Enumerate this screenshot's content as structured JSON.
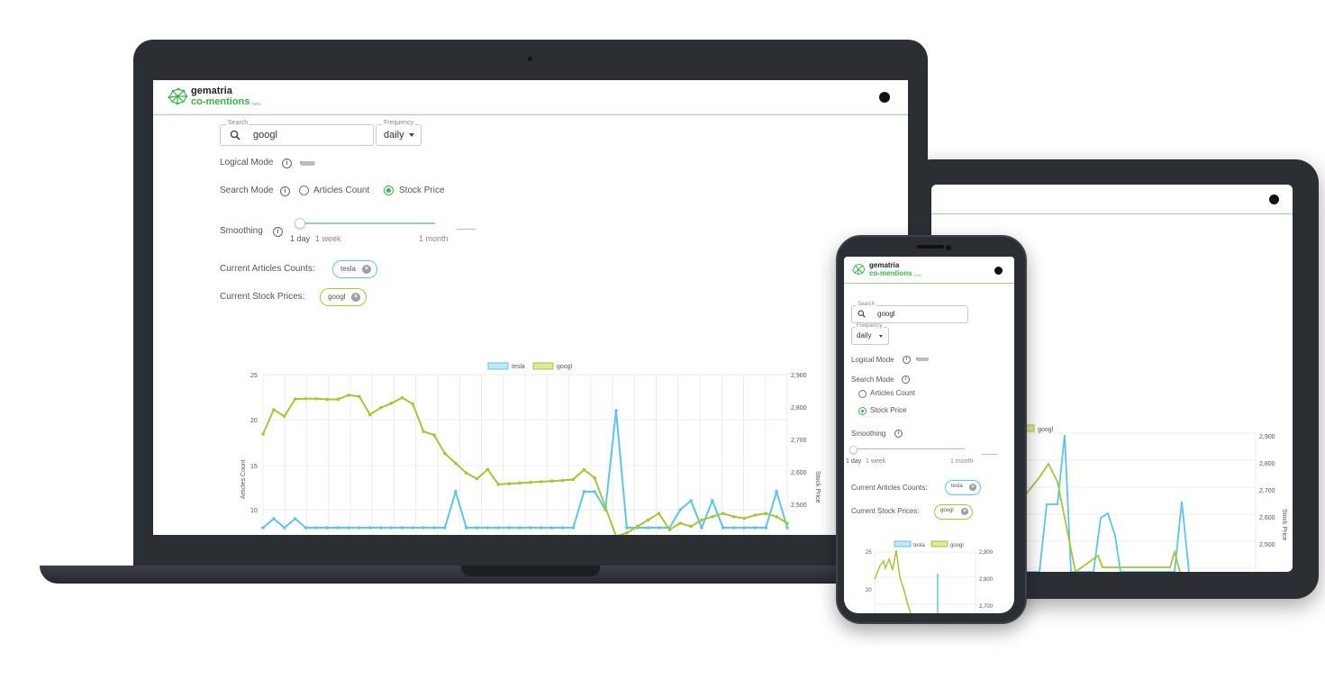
{
  "app": {
    "logo_name": "gematria",
    "logo_sub": "co-mentions",
    "logo_badge": "beta",
    "search_label": "Search",
    "search_value": "googl",
    "frequency_label": "Frequency",
    "frequency_value": "daily",
    "logical_mode_label": "Logical Mode",
    "search_mode_label": "Search Mode",
    "search_mode_options": [
      "Articles Count",
      "Stock Price"
    ],
    "search_mode_selected": "Stock Price",
    "smoothing_label": "Smoothing",
    "smoothing_ticks": [
      "1 day",
      "1 week",
      "1 month"
    ],
    "current_articles_label": "Current Articles Counts:",
    "current_articles_chips": [
      "tesla"
    ],
    "current_prices_label": "Current Stock Prices:",
    "current_prices_chips": [
      "googl"
    ]
  },
  "colors": {
    "accent_green": "#3bb34a",
    "tesla_series": "#5bc6e8",
    "googl_series": "#a8c43a",
    "device_frame": "#2b2e33"
  },
  "chart_data": {
    "type": "line",
    "legend": [
      "tesla",
      "googl"
    ],
    "y_left_label": "Articles Count",
    "y_right_label": "Stock Price",
    "y_left_ticks": [
      "25",
      "20",
      "15",
      "10"
    ],
    "y_right_ticks": [
      "2,900",
      "2,800",
      "2,700",
      "2,600",
      "2,500"
    ],
    "y_left_range": [
      8.5,
      25
    ],
    "y_right_range": [
      2410,
      2900
    ],
    "series": [
      {
        "name": "tesla",
        "axis": "left",
        "values": [
          8,
          9,
          8,
          9,
          8,
          8,
          8,
          8,
          8,
          8,
          8,
          8,
          8,
          8,
          8,
          8,
          8,
          8,
          12,
          8,
          8,
          8,
          8,
          8,
          8,
          8,
          8,
          8,
          8,
          8,
          12,
          12,
          10,
          21,
          8,
          8,
          8,
          8,
          8,
          10,
          11,
          8,
          11,
          8,
          8,
          8,
          8,
          8,
          12,
          8
        ]
      },
      {
        "name": "googl",
        "axis": "right",
        "values": [
          2725,
          2800,
          2780,
          2833,
          2834,
          2834,
          2832,
          2832,
          2845,
          2841,
          2785,
          2806,
          2820,
          2837,
          2818,
          2733,
          2722,
          2665,
          2635,
          2605,
          2587,
          2616,
          2570,
          2572,
          2574,
          2576,
          2578,
          2580,
          2582,
          2585,
          2615,
          2590,
          2500,
          2410,
          2420,
          2440,
          2460,
          2480,
          2430,
          2450,
          2440,
          2460,
          2470,
          2480,
          2470,
          2465,
          2475,
          2480,
          2470,
          2450
        ]
      }
    ]
  }
}
